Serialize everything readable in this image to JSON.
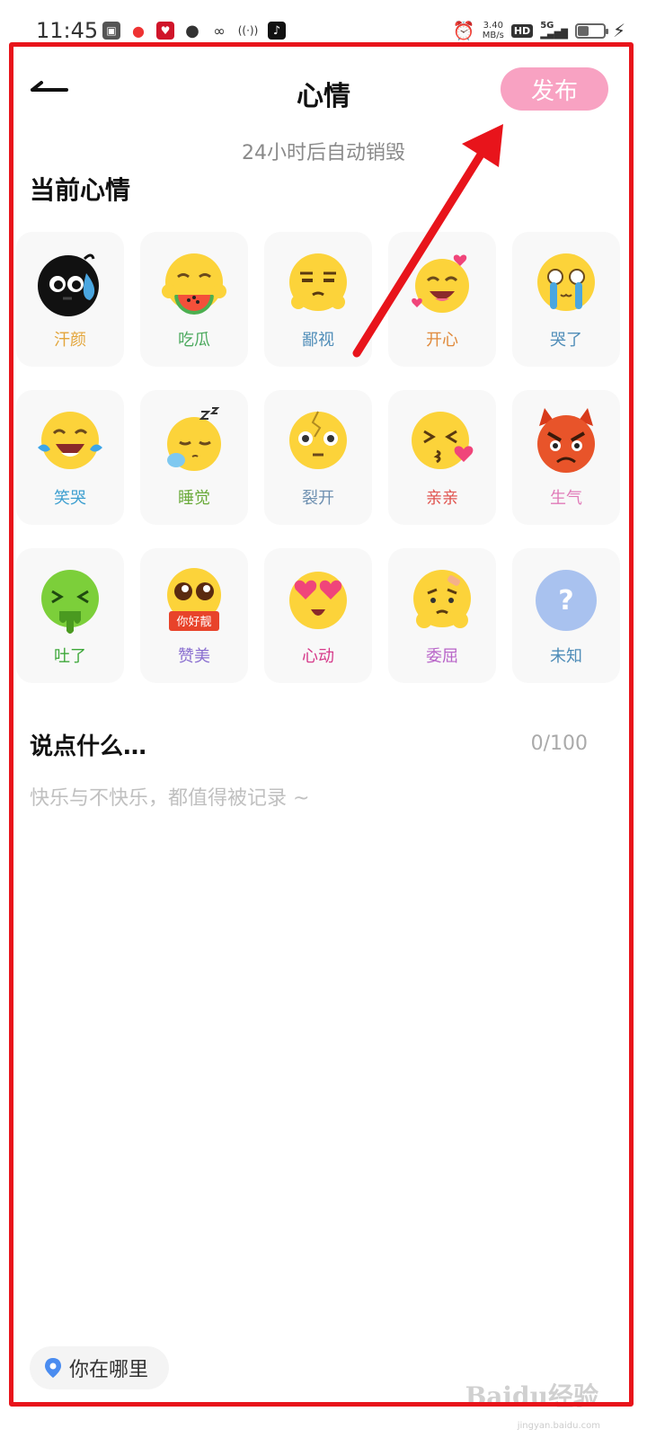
{
  "status_bar": {
    "time": "11:45",
    "speed_value": "3.40",
    "speed_unit": "MB/s",
    "hd": "HD",
    "network": "5G"
  },
  "header": {
    "title": "心情",
    "publish_label": "发布"
  },
  "subtitle": "24小时后自动销毁",
  "section_title": "当前心情",
  "moods": [
    {
      "label": "汗颜",
      "color": "#e3a53a",
      "icon": "sweat-face"
    },
    {
      "label": "吃瓜",
      "color": "#4daa5f",
      "icon": "eat-melon-face"
    },
    {
      "label": "鄙视",
      "color": "#4f8db8",
      "icon": "disdain-face"
    },
    {
      "label": "开心",
      "color": "#e08a3c",
      "icon": "happy-face"
    },
    {
      "label": "哭了",
      "color": "#4f8db8",
      "icon": "crying-face"
    },
    {
      "label": "笑哭",
      "color": "#3d9fd0",
      "icon": "laugh-cry-face"
    },
    {
      "label": "睡觉",
      "color": "#6aaa3a",
      "icon": "sleeping-face"
    },
    {
      "label": "裂开",
      "color": "#6d8fb0",
      "icon": "cracked-face"
    },
    {
      "label": "亲亲",
      "color": "#e0544f",
      "icon": "kiss-face"
    },
    {
      "label": "生气",
      "color": "#e07ab8",
      "icon": "angry-face"
    },
    {
      "label": "吐了",
      "color": "#3ea83a",
      "icon": "vomit-face"
    },
    {
      "label": "赞美",
      "color": "#8a6fd0",
      "icon": "praise-face"
    },
    {
      "label": "心动",
      "color": "#d63a8a",
      "icon": "heart-eyes-face"
    },
    {
      "label": "委屈",
      "color": "#b864c8",
      "icon": "wronged-face"
    },
    {
      "label": "未知",
      "color": "#4f8db8",
      "icon": "unknown-face"
    }
  ],
  "praise_sign": "你好靓",
  "unknown_mark": "?",
  "compose": {
    "title": "说点什么…",
    "counter": "0/100",
    "placeholder": "快乐与不快乐，都值得被记录 ~"
  },
  "location": {
    "label": "你在哪里"
  },
  "watermark": {
    "brand": "Baidu经验",
    "url": "jingyan.baidu.com"
  }
}
